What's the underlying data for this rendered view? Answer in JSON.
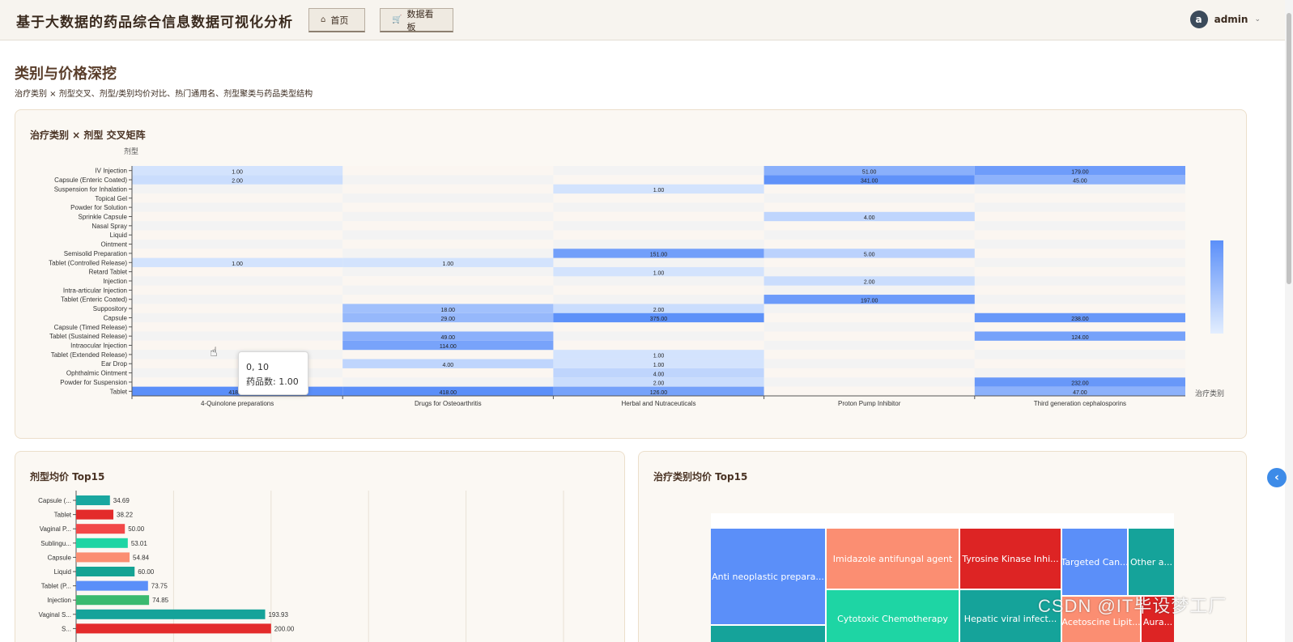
{
  "app": {
    "title": "基于大数据的药品综合信息数据可视化分析",
    "tabs": [
      {
        "label": "首页",
        "icon": "home-icon"
      },
      {
        "label": "数据看板",
        "icon": "cart-icon"
      }
    ],
    "user": {
      "avatar_letter": "a",
      "name": "admin"
    }
  },
  "page": {
    "title": "类别与价格深挖",
    "subtitle": "治疗类别 × 剂型交叉、剂型/类别均价对比、热门通用名、剂型聚类与药品类型结构"
  },
  "heatmap_card": {
    "title": "治疗类别 × 剂型 交叉矩阵",
    "y_axis_name": "剂型",
    "x_axis_name": "治疗类别",
    "tooltip": {
      "coord": "0, 10",
      "label": "药品数:",
      "value": "1.00"
    }
  },
  "dosage_card": {
    "title": "剂型均价 Top15"
  },
  "category_card": {
    "title": "治疗类别均价 Top15"
  },
  "watermark": "CSDN @IT毕设梦工厂",
  "chart_data": [
    {
      "type": "heatmap",
      "x_categories": [
        "4-Quinolone preparations",
        "Drugs for Osteoarthritis",
        "Herbal and Nutraceuticals",
        "Proton Pump Inhibitor",
        "Third generation cephalosporins"
      ],
      "y_categories": [
        "IV Injection",
        "Capsule (Enteric Coated)",
        "Suspension for Inhalation",
        "Topical Gel",
        "Powder for Solution",
        "Sprinkle Capsule",
        "Nasal Spray",
        "Liquid",
        "Ointment",
        "Semisolid Preparation",
        "Tablet (Controlled Release)",
        "Retard Tablet",
        "Injection",
        "Intra-articular Injection",
        "Tablet (Enteric Coated)",
        "Suppository",
        "Capsule",
        "Capsule (Timed Release)",
        "Tablet (Sustained Release)",
        "Intraocular Injection",
        "Tablet (Extended Release)",
        "Ear Drop",
        "Ophthalmic Ointment",
        "Powder for Suspension",
        "Tablet"
      ],
      "cells": [
        {
          "x": 0,
          "y": 0,
          "value": 1.0
        },
        {
          "x": 0,
          "y": 1,
          "value": 2.0
        },
        {
          "x": 0,
          "y": 10,
          "value": 1.0
        },
        {
          "x": 0,
          "y": 24,
          "value": 418.0
        },
        {
          "x": 1,
          "y": 10,
          "value": 1.0
        },
        {
          "x": 1,
          "y": 15,
          "value": 18.0
        },
        {
          "x": 1,
          "y": 16,
          "value": 29.0
        },
        {
          "x": 1,
          "y": 18,
          "value": 49.0
        },
        {
          "x": 1,
          "y": 19,
          "value": 114.0
        },
        {
          "x": 1,
          "y": 21,
          "value": 4.0
        },
        {
          "x": 1,
          "y": 24,
          "value": 418.0
        },
        {
          "x": 2,
          "y": 2,
          "value": 1.0
        },
        {
          "x": 2,
          "y": 9,
          "value": 151.0
        },
        {
          "x": 2,
          "y": 11,
          "value": 1.0
        },
        {
          "x": 2,
          "y": 15,
          "value": 2.0
        },
        {
          "x": 2,
          "y": 16,
          "value": 375.0
        },
        {
          "x": 2,
          "y": 20,
          "value": 1.0
        },
        {
          "x": 2,
          "y": 21,
          "value": 1.0
        },
        {
          "x": 2,
          "y": 22,
          "value": 4.0
        },
        {
          "x": 2,
          "y": 23,
          "value": 2.0
        },
        {
          "x": 2,
          "y": 24,
          "value": 126.0
        },
        {
          "x": 3,
          "y": 0,
          "value": 51.0
        },
        {
          "x": 3,
          "y": 1,
          "value": 341.0
        },
        {
          "x": 3,
          "y": 5,
          "value": 4.0
        },
        {
          "x": 3,
          "y": 9,
          "value": 5.0
        },
        {
          "x": 3,
          "y": 12,
          "value": 2.0
        },
        {
          "x": 3,
          "y": 14,
          "value": 197.0
        },
        {
          "x": 4,
          "y": 0,
          "value": 179.0
        },
        {
          "x": 4,
          "y": 1,
          "value": 45.0
        },
        {
          "x": 4,
          "y": 16,
          "value": 238.0
        },
        {
          "x": 4,
          "y": 18,
          "value": 124.0
        },
        {
          "x": 4,
          "y": 23,
          "value": 232.0
        },
        {
          "x": 4,
          "y": 24,
          "value": 47.0
        }
      ],
      "value_label": "药品数"
    },
    {
      "type": "bar",
      "orientation": "horizontal",
      "categories": [
        "Capsule (...",
        "Tablet",
        "Vaginal P...",
        "Sublingu...",
        "Capsule",
        "Liquid",
        "Tablet (P...",
        "Injection",
        "Vaginal S...",
        "S..."
      ],
      "values": [
        34.69,
        38.22,
        50.0,
        53.01,
        54.84,
        60.0,
        73.75,
        74.85,
        193.93,
        200.0
      ],
      "value_labels": [
        "34.69",
        "38.22",
        "50.00",
        "53.01",
        "54.84",
        "60.00",
        "73.75",
        "74.85",
        "193.93",
        "200.00"
      ],
      "colors": [
        "#1aa7a0",
        "#e32b2b",
        "#f24848",
        "#1ed5a4",
        "#fb8e72",
        "#15a394",
        "#5b8ff9",
        "#3aba6f",
        "#15a39a",
        "#e32b2b"
      ]
    },
    {
      "type": "treemap",
      "items": [
        {
          "name": "Anti neoplastic prepara...",
          "color": "#5b8ff9"
        },
        {
          "name": "Imidazole antifungal agent",
          "color": "#fb8e72"
        },
        {
          "name": "Tyrosine Kinase Inhi...",
          "color": "#dd2424"
        },
        {
          "name": "Targeted Can...",
          "color": "#5b8ff9"
        },
        {
          "name": "Other a...",
          "color": "#15a39a"
        },
        {
          "name": "Cytotoxic Chemotherapy",
          "color": "#1ed5a4"
        },
        {
          "name": "Hepatic viral infect...",
          "color": "#15a39a"
        },
        {
          "name": "Acetoscine Lipit...",
          "color": "#fb8e72"
        },
        {
          "name": "Aura...",
          "color": "#dd2424"
        }
      ]
    }
  ]
}
